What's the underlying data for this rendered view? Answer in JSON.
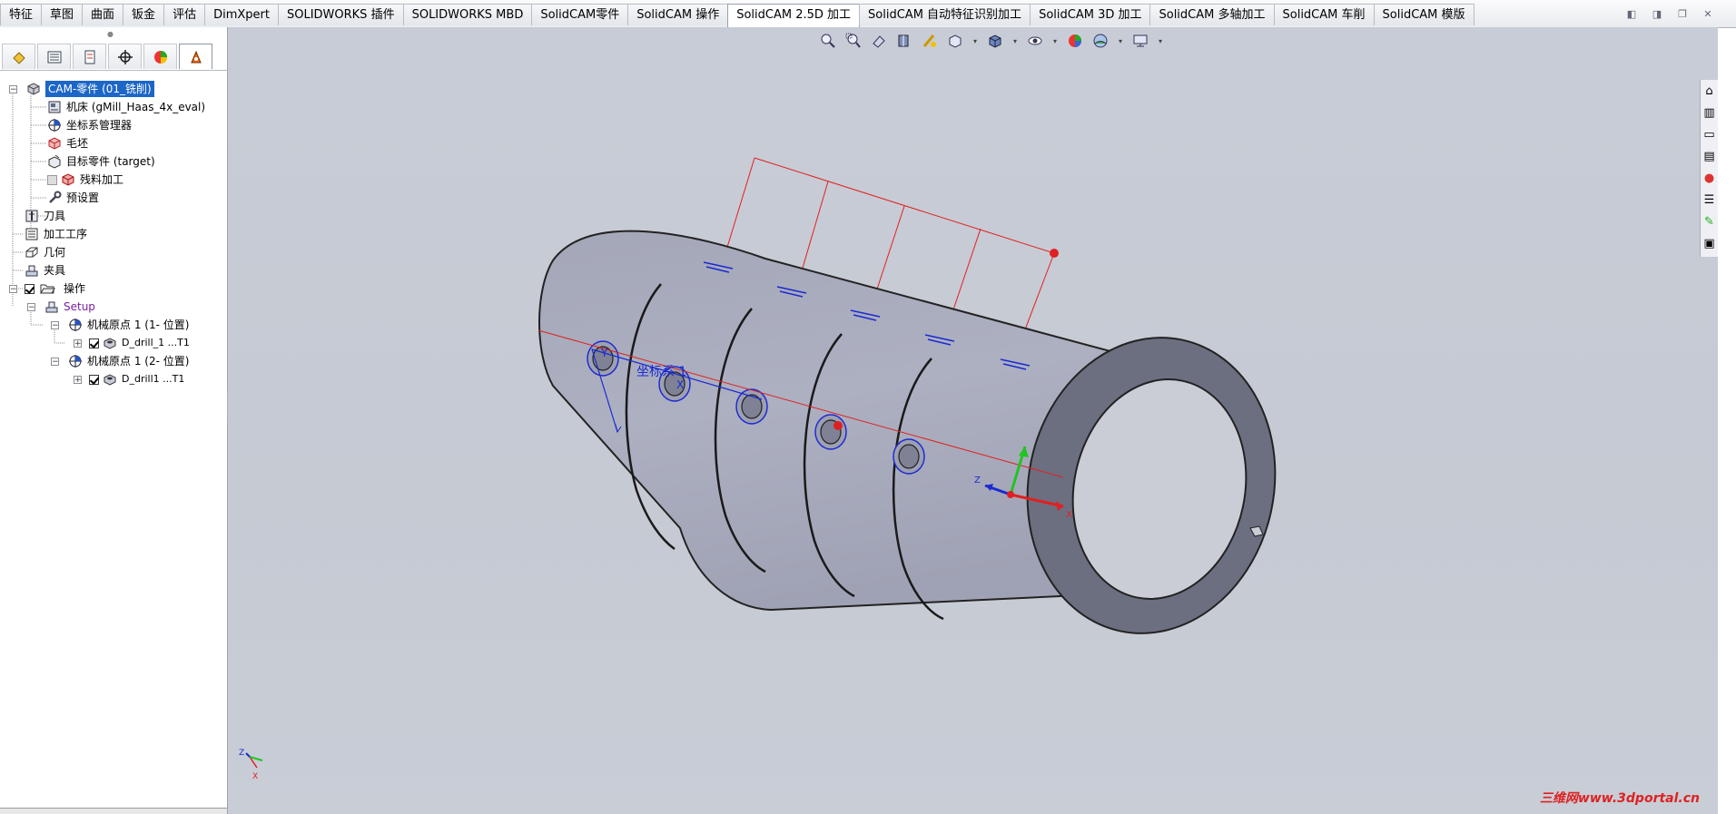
{
  "tabs": [
    "特征",
    "草图",
    "曲面",
    "钣金",
    "评估",
    "DimXpert",
    "SOLIDWORKS 插件",
    "SOLIDWORKS MBD",
    "SolidCAM零件",
    "SolidCAM 操作",
    "SolidCAM 2.5D 加工",
    "SolidCAM 自动特征识别加工",
    "SolidCAM 3D 加工",
    "SolidCAM 多轴加工",
    "SolidCAM 车削",
    "SolidCAM 模版"
  ],
  "active_tab_index": 10,
  "tree": {
    "root": "CAM-零件 (01_铣削)",
    "machine": "机床 (gMill_Haas_4x_eval)",
    "coord_manager": "坐标系管理器",
    "stock": "毛坯",
    "target": "目标零件 (target)",
    "rest_machining": "残料加工",
    "presets": "预设置",
    "tools": "刀具",
    "processes": "加工工序",
    "geometry": "几何",
    "fixtures": "夹具",
    "operations": "操作",
    "setup": "Setup",
    "origin1": "机械原点 1 (1- 位置)",
    "op1": "D_drill_1 ...T1",
    "origin2": "机械原点 1 (2- 位置)",
    "op2": "D_drill1 ...T1"
  },
  "viewport": {
    "coord_label": "坐标系 1",
    "axis_x": "X",
    "axis_y": "Y",
    "axis_z": "Z"
  },
  "watermark": "三维网www.3dportal.cn",
  "colors": {
    "part": "#a9acbd",
    "selection": "#1c66c8",
    "accent_red": "#e02020",
    "axis_blue": "#1a2ad0",
    "axis_green": "#22c322"
  }
}
